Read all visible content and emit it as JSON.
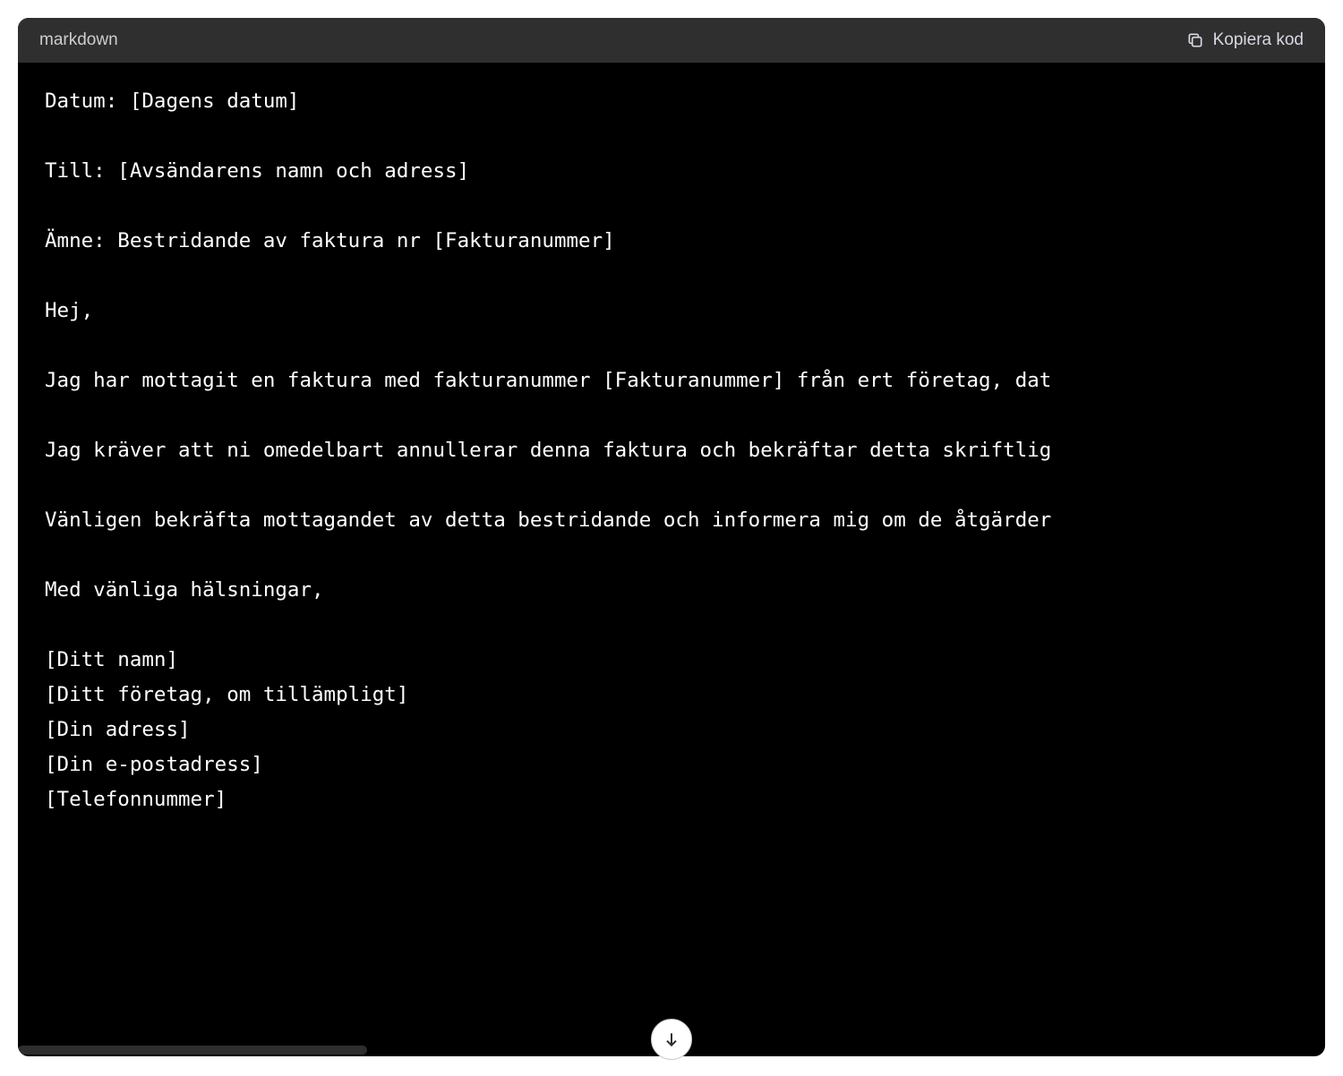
{
  "codeBlock": {
    "language": "markdown",
    "copyLabel": "Kopiera kod",
    "content": "Datum: [Dagens datum]\n\nTill: [Avsändarens namn och adress]\n\nÄmne: Bestridande av faktura nr [Fakturanummer]\n\nHej,\n\nJag har mottagit en faktura med fakturanummer [Fakturanummer] från ert företag, dat\n\nJag kräver att ni omedelbart annullerar denna faktura och bekräftar detta skriftlig\n\nVänligen bekräfta mottagandet av detta bestridande och informera mig om de åtgärder\n\nMed vänliga hälsningar,\n\n[Ditt namn]\n[Ditt företag, om tillämpligt]\n[Din adress]\n[Din e-postadress]\n[Telefonnummer]"
  }
}
